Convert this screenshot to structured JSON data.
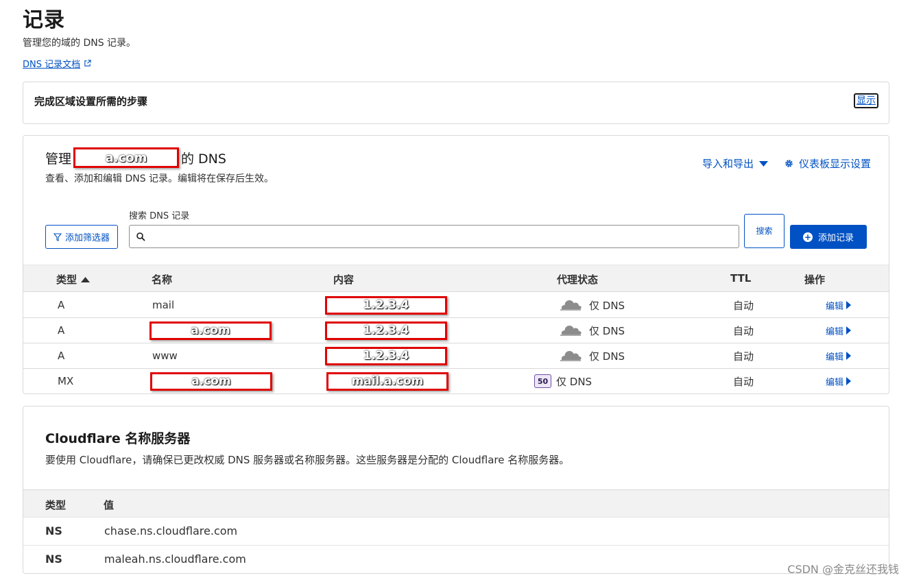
{
  "header": {
    "title": "记录",
    "subtitle": "管理您的域的 DNS 记录。",
    "doc_link": "DNS 记录文档"
  },
  "steps_card": {
    "title": "完成区域设置所需的步骤",
    "show_label": "显示"
  },
  "dns_card": {
    "title_prefix": "管理",
    "domain_redacted": "a.com",
    "title_suffix": "的 DNS",
    "subtitle": "查看、添加和编辑 DNS 记录。编辑将在保存后生效。",
    "import_export": "导入和导出",
    "dashboard_settings": "仪表板显示设置",
    "search_label": "搜索 DNS 记录",
    "search_placeholder": "",
    "filter_button": "添加筛选器",
    "search_button": "搜索",
    "add_button": "添加记录",
    "columns": {
      "type": "类型",
      "name": "名称",
      "content": "内容",
      "proxy": "代理状态",
      "ttl": "TTL",
      "actions": "操作"
    },
    "records": [
      {
        "type": "A",
        "name": "mail",
        "content": "1.2.3.4",
        "priority": "",
        "proxy": "仅 DNS",
        "ttl": "自动",
        "action": "编辑"
      },
      {
        "type": "A",
        "name": "a.com",
        "content": "1.2.3.4",
        "priority": "",
        "proxy": "仅 DNS",
        "ttl": "自动",
        "action": "编辑"
      },
      {
        "type": "A",
        "name": "www",
        "content": "1.2.3.4",
        "priority": "",
        "proxy": "仅 DNS",
        "ttl": "自动",
        "action": "编辑"
      },
      {
        "type": "MX",
        "name": "a.com",
        "content": "mail.a.com",
        "priority": "50",
        "proxy": "仅 DNS",
        "ttl": "自动",
        "action": "编辑"
      }
    ]
  },
  "ns_card": {
    "title": "Cloudflare 名称服务器",
    "subtitle": "要使用 Cloudflare，请确保已更改权威 DNS 服务器或名称服务器。这些服务器是分配的 Cloudflare 名称服务器。",
    "columns": {
      "type": "类型",
      "value": "值"
    },
    "rows": [
      {
        "type": "NS",
        "value": "chase.ns.cloudflare.com"
      },
      {
        "type": "NS",
        "value": "maleah.ns.cloudflare.com"
      }
    ]
  },
  "watermark": "CSDN @金克丝还我钱",
  "colors": {
    "link": "#0051c3",
    "redaction": "#e00000",
    "primary": "#0051c3"
  }
}
